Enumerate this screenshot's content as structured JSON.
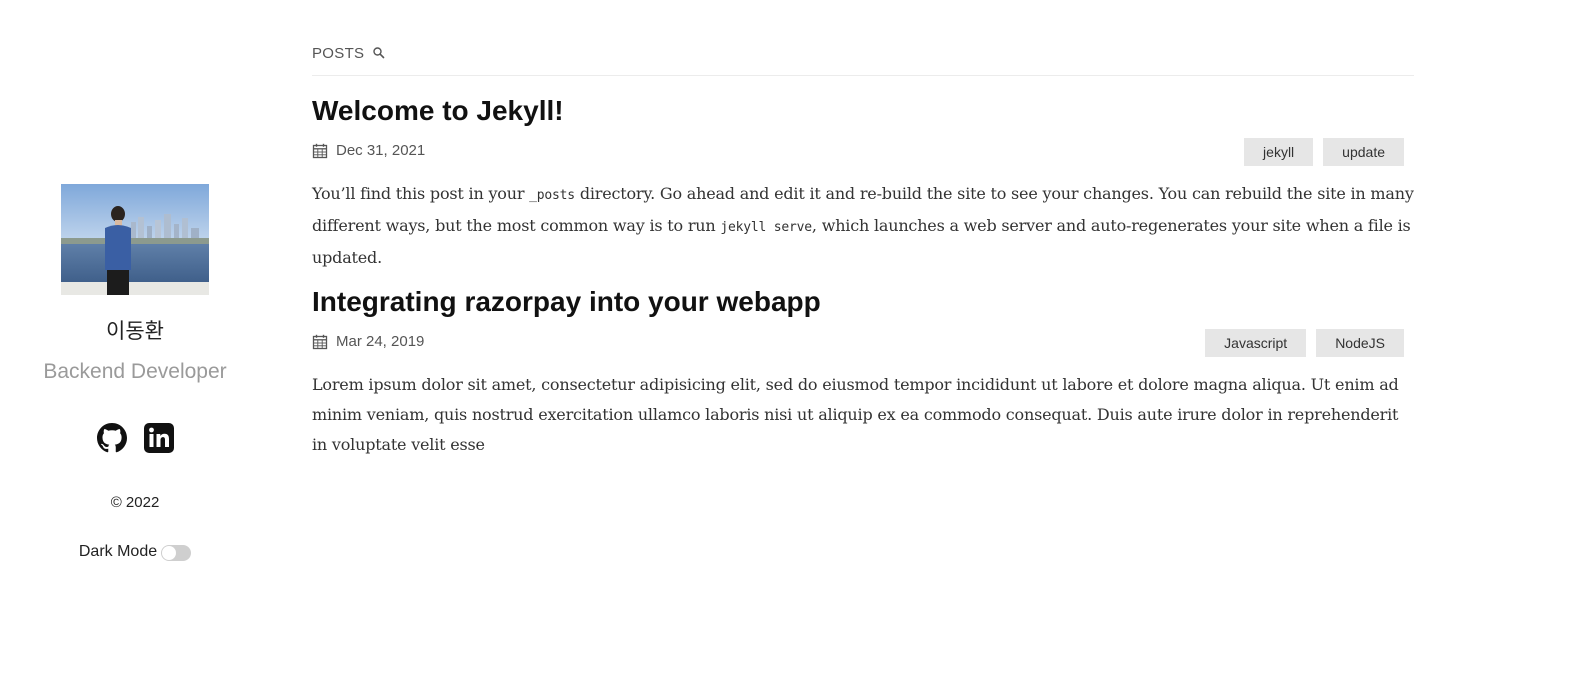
{
  "sidebar": {
    "avatar_alt": "profile photo",
    "name": "이동환",
    "role": "Backend Developer",
    "social": [
      {
        "icon": "github-icon"
      },
      {
        "icon": "linkedin-icon"
      }
    ],
    "copyright": "© 2022",
    "dark_mode_label": "Dark Mode",
    "dark_mode_on": false
  },
  "nav": {
    "posts_label": "POSTS",
    "search_icon": "search-icon"
  },
  "posts": [
    {
      "title": "Welcome to Jekyll!",
      "date": "Dec 31, 2021",
      "tags": [
        "jekyll",
        "update"
      ],
      "excerpt_parts": [
        "You’ll find this post in your ",
        "_posts",
        " directory. Go ahead and edit it and re-build the site to see your changes. You can rebuild the site in many different ways, but the most common way is to run ",
        "jekyll serve",
        ", which launches a web server and auto-regenerates your site when a file is updated."
      ]
    },
    {
      "title": "Integrating razorpay into your webapp",
      "date": "Mar 24, 2019",
      "tags": [
        "Javascript",
        "NodeJS"
      ],
      "excerpt": "Lorem ipsum dolor sit amet, consectetur adipisicing elit, sed do eiusmod tempor incididunt ut labore et dolore magna aliqua. Ut enim ad minim veniam, quis nostrud exercitation ullamco laboris nisi ut aliquip ex ea commodo consequat. Duis aute irure dolor in reprehenderit in voluptate velit esse"
    }
  ],
  "colors": {
    "tag_bg": "#e6e6e6",
    "muted": "#9a9a9a",
    "title": "#111111"
  }
}
